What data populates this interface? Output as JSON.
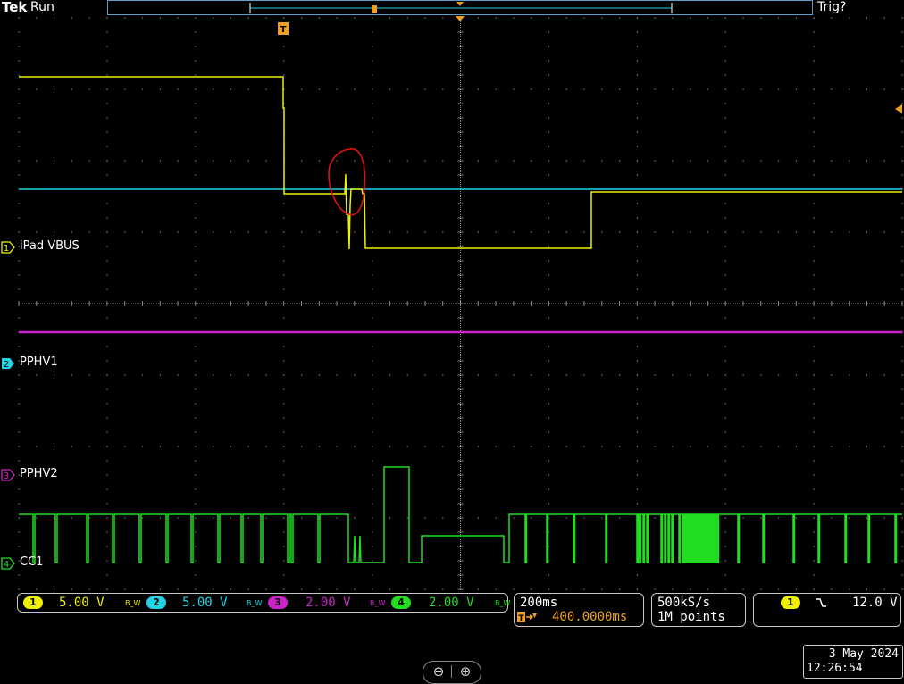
{
  "header": {
    "brand": "Tek",
    "state": "Run",
    "trigger_status": "Trig?"
  },
  "channels": [
    {
      "id": "1",
      "name": "iPad VBUS",
      "color": "#f0f000",
      "scale": "5.00 V",
      "bw_label": "B_W"
    },
    {
      "id": "2",
      "name": "PPHV1",
      "color": "#22d3e6",
      "scale": "5.00 V",
      "bw_label": "B_W"
    },
    {
      "id": "3",
      "name": "PPHV2",
      "color": "#cc22cc",
      "scale": "2.00 V",
      "bw_label": "B_W"
    },
    {
      "id": "4",
      "name": "CC1",
      "color": "#22dd22",
      "scale": "2.00 V",
      "bw_label": "B_W"
    }
  ],
  "timebase": {
    "per_div": "200ms",
    "delay": "400.0000ms",
    "sample_rate": "500kS/s",
    "record_length": "1M points"
  },
  "trigger": {
    "source": "1",
    "slope_icon": "falling-edge-icon",
    "level": "12.0 V"
  },
  "datetime": {
    "date": "3 May 2024",
    "time": "12:26:54"
  },
  "markers": {
    "trigger_marker": "T"
  },
  "zoom": {
    "out_icon": "zoom-out-icon",
    "in_icon": "zoom-in-icon"
  },
  "colors": {
    "grid": "#8a8a8a",
    "annotation": "#e01010",
    "orange": "#f0a020",
    "border": "#5aa0c8"
  }
}
